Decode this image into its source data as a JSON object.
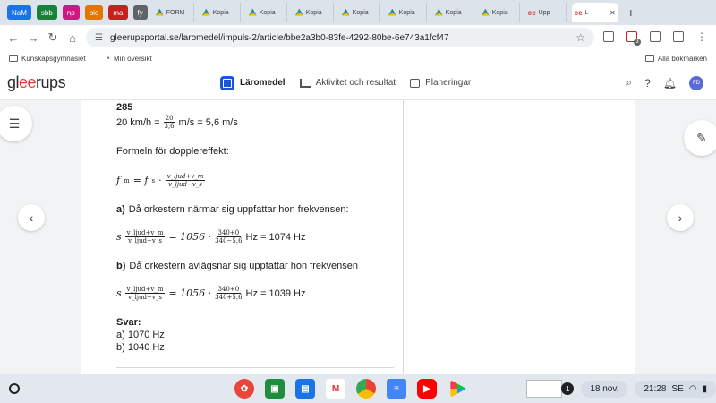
{
  "browser": {
    "tabs": [
      {
        "label": "NaM",
        "color": "#1a73e8"
      },
      {
        "label": "sbb",
        "color": "#188038"
      },
      {
        "label": "np",
        "color": "#d01884"
      },
      {
        "label": "bio",
        "color": "#e37400"
      },
      {
        "label": "ma",
        "color": "#c5221f"
      },
      {
        "label": "fy",
        "color": "#5f6368"
      }
    ],
    "page_tabs": [
      "FORM",
      "Kopia",
      "Kopia",
      "Kopia",
      "Kopia",
      "Kopia",
      "Kopia",
      "Kopia",
      "Upp",
      "L"
    ],
    "url": "gleerupsportal.se/laromedel/impuls-2/article/bbe2a3b0-83fe-4292-80be-6e743a1fcf47",
    "extension_badge": "3",
    "bookmarks": [
      "Kunskapsgymnasiet",
      "Min översikt"
    ],
    "all_bookmarks": "Alla bokmärken"
  },
  "app": {
    "logo_pre": "gl",
    "logo_ee": "ee",
    "logo_post": "rups",
    "nav": [
      "Läromedel",
      "Aktivitet och resultat",
      "Planeringar"
    ],
    "avatar": "FD"
  },
  "article": {
    "problem_number": "285",
    "speed_lhs": "20 km/h =",
    "speed_num": "20",
    "speed_den": "3,6",
    "speed_rhs": "m/s = 5,6 m/s",
    "doppler_intro": "Formeln för dopplereffekt:",
    "formula_lhs": "f",
    "formula_lhs_sub": "m",
    "formula_eq": "= f",
    "formula_eq_sub": "s",
    "formula_dot": "·",
    "frac_num": "v_ljud+v_m",
    "frac_den": "v_ljud−v_s",
    "a_label": "a)",
    "a_text": "Då orkestern närmar sig uppfattar hon frekvensen:",
    "a_calc_pre": "= 1056 ·",
    "a_num": "340+0",
    "a_den": "340−5,6",
    "a_result": "Hz = 1074 Hz",
    "b_label": "b)",
    "b_text": "Då orkestern avlägsnar sig uppfattar hon frekvensen",
    "b_num": "340+0",
    "b_den": "340+5,6",
    "b_result": "Hz = 1039 Hz",
    "svar_label": "Svar:",
    "svar_a": "a) 1070 Hz",
    "svar_b": "b) 1040 Hz"
  },
  "taskbar": {
    "notification_count": "1",
    "date": "18 nov.",
    "time": "21:28",
    "locale": "SE"
  }
}
